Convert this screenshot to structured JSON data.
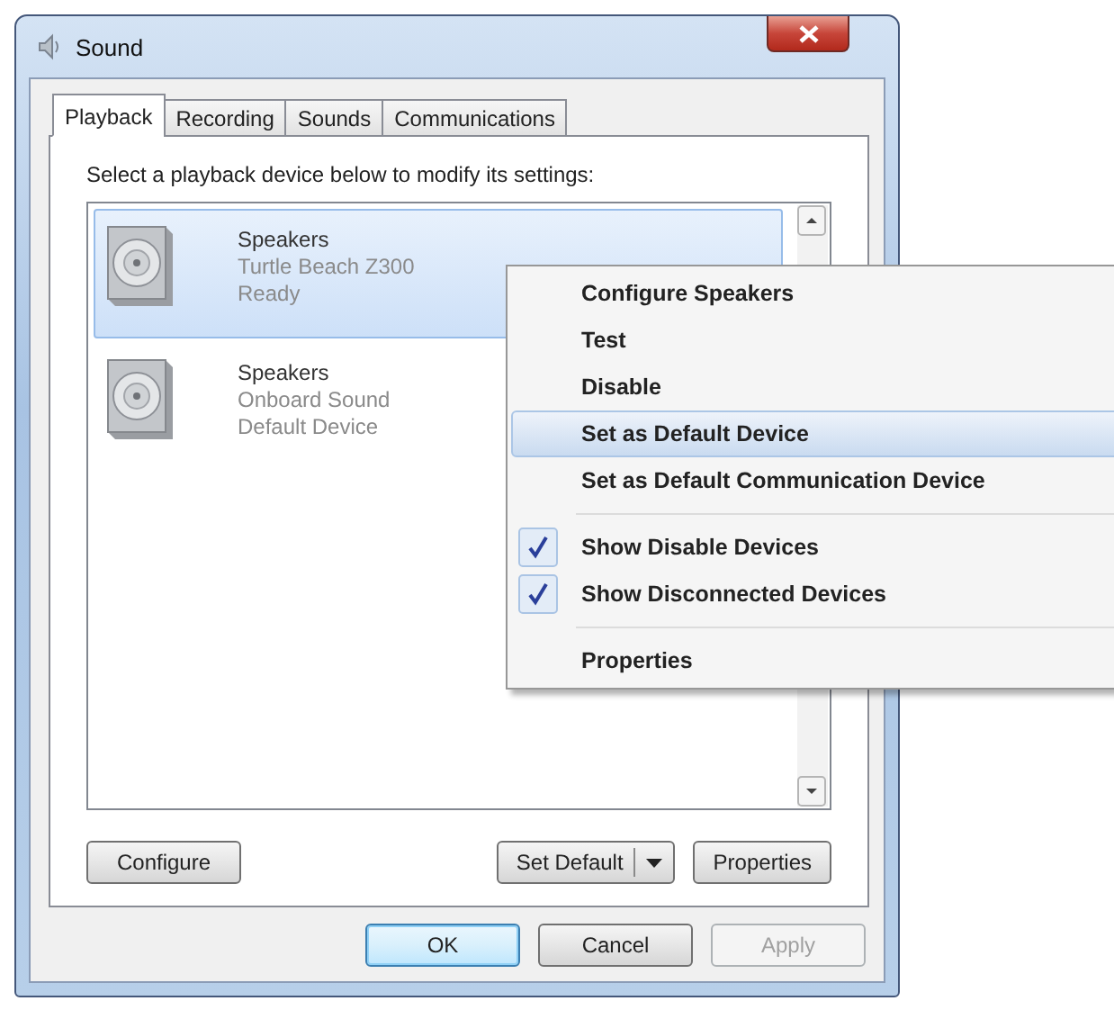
{
  "window": {
    "title": "Sound"
  },
  "tabs": [
    {
      "label": "Playback",
      "selected": true
    },
    {
      "label": "Recording",
      "selected": false
    },
    {
      "label": "Sounds",
      "selected": false
    },
    {
      "label": "Communications",
      "selected": false
    }
  ],
  "instruction": "Select a playback device below to modify its settings:",
  "devices": [
    {
      "name": "Speakers",
      "description": "Turtle Beach Z300",
      "status": "Ready",
      "selected": true
    },
    {
      "name": "Speakers",
      "description": "Onboard Sound",
      "status": "Default Device",
      "selected": false
    }
  ],
  "list_buttons": [
    {
      "label": "Configure",
      "kind": "plain"
    },
    {
      "label": "Set Default",
      "kind": "split"
    },
    {
      "label": "Properties",
      "kind": "plain"
    }
  ],
  "dialog_buttons": [
    {
      "label": "OK",
      "default": true,
      "disabled": false
    },
    {
      "label": "Cancel",
      "default": false,
      "disabled": false
    },
    {
      "label": "Apply",
      "default": false,
      "disabled": true
    }
  ],
  "context_menu": {
    "items": [
      {
        "kind": "item",
        "label": "Configure Speakers",
        "selected": false
      },
      {
        "kind": "item",
        "label": "Test",
        "selected": false
      },
      {
        "kind": "item",
        "label": "Disable",
        "selected": false
      },
      {
        "kind": "item",
        "label": "Set as Default Device",
        "selected": true
      },
      {
        "kind": "item",
        "label": "Set as Default Communication Device",
        "selected": false
      },
      {
        "kind": "separator"
      },
      {
        "kind": "check",
        "label": "Show Disable Devices",
        "checked": true,
        "selected": false
      },
      {
        "kind": "check",
        "label": "Show Disconnected Devices",
        "checked": true,
        "selected": false
      },
      {
        "kind": "separator"
      },
      {
        "kind": "item",
        "label": "Properties",
        "selected": false
      }
    ]
  }
}
